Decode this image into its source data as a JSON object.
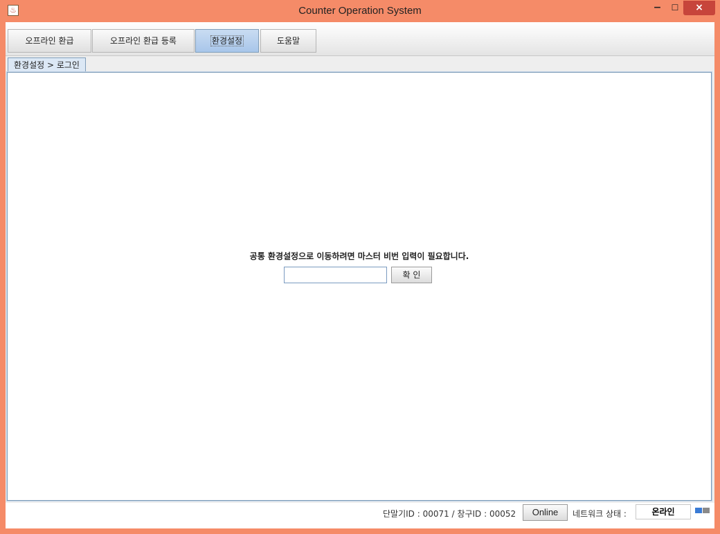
{
  "window": {
    "title": "Counter Operation System",
    "controls": {
      "minimize": "−",
      "maximize": "☐",
      "close": "×"
    },
    "app_icon": "java-cup-icon"
  },
  "menu": {
    "tabs": [
      {
        "label": "오프라인 환급",
        "active": false
      },
      {
        "label": "오프라인 환급 등록",
        "active": false
      },
      {
        "label": "환경설정",
        "active": true
      },
      {
        "label": "도움말",
        "active": false
      }
    ]
  },
  "breadcrumb": "환경설정 > 로그인",
  "login": {
    "prompt": "공통 환경설정으로 이동하려면 마스터 비번 입력이 필요합니다.",
    "password_value": "",
    "confirm_label": "확 인"
  },
  "status": {
    "ids_text": "단말기ID : 00071 / 창구ID : 00052",
    "online_button": "Online",
    "network_label": "네트워크 상태 :",
    "network_value": "온라인",
    "network_icon": "network-status-icon"
  },
  "colors": {
    "window_frame": "#f58b68",
    "close_button": "#c7453b",
    "active_tab": "#a8c6ea",
    "content_border": "#7f9db9",
    "network_icon_blue": "#3a7bd5",
    "network_icon_gray": "#8a8a8a"
  }
}
